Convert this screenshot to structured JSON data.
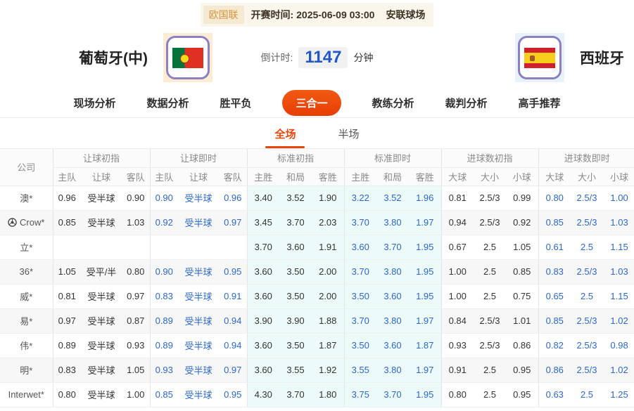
{
  "topbar": {
    "league": "欧国联",
    "kickoff_label": "开赛时间:",
    "kickoff_time": "2025-06-09 03:00",
    "venue": "安联球场"
  },
  "match": {
    "home_team": "葡萄牙(中)",
    "away_team": "西班牙",
    "countdown_label": "倒计时:",
    "countdown_value": "1147",
    "countdown_unit": "分钟"
  },
  "colors": {
    "accent_orange": "#e8470b",
    "live_blue": "#2d68c4",
    "standard_col_bg": "#edfafa",
    "badge_orange": "#d6953f"
  },
  "nav": {
    "items": [
      {
        "label": "现场分析",
        "active": false
      },
      {
        "label": "数据分析",
        "active": false
      },
      {
        "label": "胜平负",
        "active": false
      },
      {
        "label": "三合一",
        "active": true
      },
      {
        "label": "教练分析",
        "active": false
      },
      {
        "label": "裁判分析",
        "active": false
      },
      {
        "label": "高手推荐",
        "active": false
      }
    ]
  },
  "sub_tabs": {
    "items": [
      {
        "label": "全场",
        "active": true
      },
      {
        "label": "半场",
        "active": false
      }
    ]
  },
  "table": {
    "company_header": "公司",
    "groups": [
      {
        "label": "让球初指",
        "cols": [
          "主队",
          "让球",
          "客队"
        ]
      },
      {
        "label": "让球即时",
        "cols": [
          "主队",
          "让球",
          "客队"
        ]
      },
      {
        "label": "标准初指",
        "cols": [
          "主胜",
          "和局",
          "客胜"
        ]
      },
      {
        "label": "标准即时",
        "cols": [
          "主胜",
          "和局",
          "客胜"
        ]
      },
      {
        "label": "进球数初指",
        "cols": [
          "大球",
          "大小",
          "小球"
        ]
      },
      {
        "label": "进球数即时",
        "cols": [
          "大球",
          "大小",
          "小球"
        ]
      }
    ],
    "rows": [
      {
        "company": "澳*",
        "has_icon": false,
        "handicap_initial": [
          "0.96",
          "受半球",
          "0.90"
        ],
        "handicap_live": [
          "0.90",
          "受半球",
          "0.96"
        ],
        "standard_initial": [
          "3.40",
          "3.52",
          "1.90"
        ],
        "standard_live": [
          "3.22",
          "3.52",
          "1.96"
        ],
        "goals_initial": [
          "0.81",
          "2.5/3",
          "0.99"
        ],
        "goals_live": [
          "0.80",
          "2.5/3",
          "1.00"
        ]
      },
      {
        "company": "Crow*",
        "has_icon": true,
        "handicap_initial": [
          "0.85",
          "受半球",
          "1.03"
        ],
        "handicap_live": [
          "0.92",
          "受半球",
          "0.97"
        ],
        "standard_initial": [
          "3.45",
          "3.70",
          "2.03"
        ],
        "standard_live": [
          "3.70",
          "3.80",
          "1.97"
        ],
        "goals_initial": [
          "0.94",
          "2.5/3",
          "0.92"
        ],
        "goals_live": [
          "0.85",
          "2.5/3",
          "1.03"
        ]
      },
      {
        "company": "立*",
        "has_icon": false,
        "handicap_initial": [
          "",
          "",
          ""
        ],
        "handicap_live": [
          "",
          "",
          ""
        ],
        "standard_initial": [
          "3.70",
          "3.60",
          "1.91"
        ],
        "standard_live": [
          "3.60",
          "3.70",
          "1.95"
        ],
        "goals_initial": [
          "0.67",
          "2.5",
          "1.05"
        ],
        "goals_live": [
          "0.61",
          "2.5",
          "1.15"
        ]
      },
      {
        "company": "36*",
        "has_icon": false,
        "handicap_initial": [
          "1.05",
          "受平/半",
          "0.80"
        ],
        "handicap_live": [
          "0.90",
          "受半球",
          "0.95"
        ],
        "standard_initial": [
          "3.60",
          "3.50",
          "2.00"
        ],
        "standard_live": [
          "3.70",
          "3.80",
          "1.95"
        ],
        "goals_initial": [
          "1.00",
          "2.5",
          "0.85"
        ],
        "goals_live": [
          "0.83",
          "2.5/3",
          "1.03"
        ]
      },
      {
        "company": "威*",
        "has_icon": false,
        "handicap_initial": [
          "0.81",
          "受半球",
          "0.97"
        ],
        "handicap_live": [
          "0.83",
          "受半球",
          "0.91"
        ],
        "standard_initial": [
          "3.60",
          "3.50",
          "2.00"
        ],
        "standard_live": [
          "3.50",
          "3.60",
          "1.95"
        ],
        "goals_initial": [
          "1.00",
          "2.5",
          "0.75"
        ],
        "goals_live": [
          "0.65",
          "2.5",
          "1.15"
        ]
      },
      {
        "company": "易*",
        "has_icon": false,
        "handicap_initial": [
          "0.97",
          "受半球",
          "0.87"
        ],
        "handicap_live": [
          "0.89",
          "受半球",
          "0.94"
        ],
        "standard_initial": [
          "3.90",
          "3.90",
          "1.88"
        ],
        "standard_live": [
          "3.70",
          "3.80",
          "1.97"
        ],
        "goals_initial": [
          "0.84",
          "2.5/3",
          "1.01"
        ],
        "goals_live": [
          "0.85",
          "2.5/3",
          "1.02"
        ]
      },
      {
        "company": "伟*",
        "has_icon": false,
        "handicap_initial": [
          "0.89",
          "受半球",
          "0.93"
        ],
        "handicap_live": [
          "0.89",
          "受半球",
          "0.94"
        ],
        "standard_initial": [
          "3.60",
          "3.50",
          "1.87"
        ],
        "standard_live": [
          "3.50",
          "3.60",
          "1.87"
        ],
        "goals_initial": [
          "0.93",
          "2.5/3",
          "0.86"
        ],
        "goals_live": [
          "0.82",
          "2.5/3",
          "0.98"
        ]
      },
      {
        "company": "明*",
        "has_icon": false,
        "handicap_initial": [
          "0.83",
          "受半球",
          "1.05"
        ],
        "handicap_live": [
          "0.93",
          "受半球",
          "0.97"
        ],
        "standard_initial": [
          "3.60",
          "3.55",
          "1.92"
        ],
        "standard_live": [
          "3.55",
          "3.80",
          "1.97"
        ],
        "goals_initial": [
          "0.91",
          "2.5",
          "0.95"
        ],
        "goals_live": [
          "0.86",
          "2.5/3",
          "1.02"
        ]
      },
      {
        "company": "Interwet*",
        "has_icon": false,
        "handicap_initial": [
          "0.80",
          "受半球",
          "1.00"
        ],
        "handicap_live": [
          "0.85",
          "受半球",
          "0.95"
        ],
        "standard_initial": [
          "4.30",
          "3.70",
          "1.80"
        ],
        "standard_live": [
          "3.75",
          "3.70",
          "1.95"
        ],
        "goals_initial": [
          "0.80",
          "2.5",
          "0.95"
        ],
        "goals_live": [
          "0.63",
          "2.5",
          "1.25"
        ]
      }
    ]
  }
}
